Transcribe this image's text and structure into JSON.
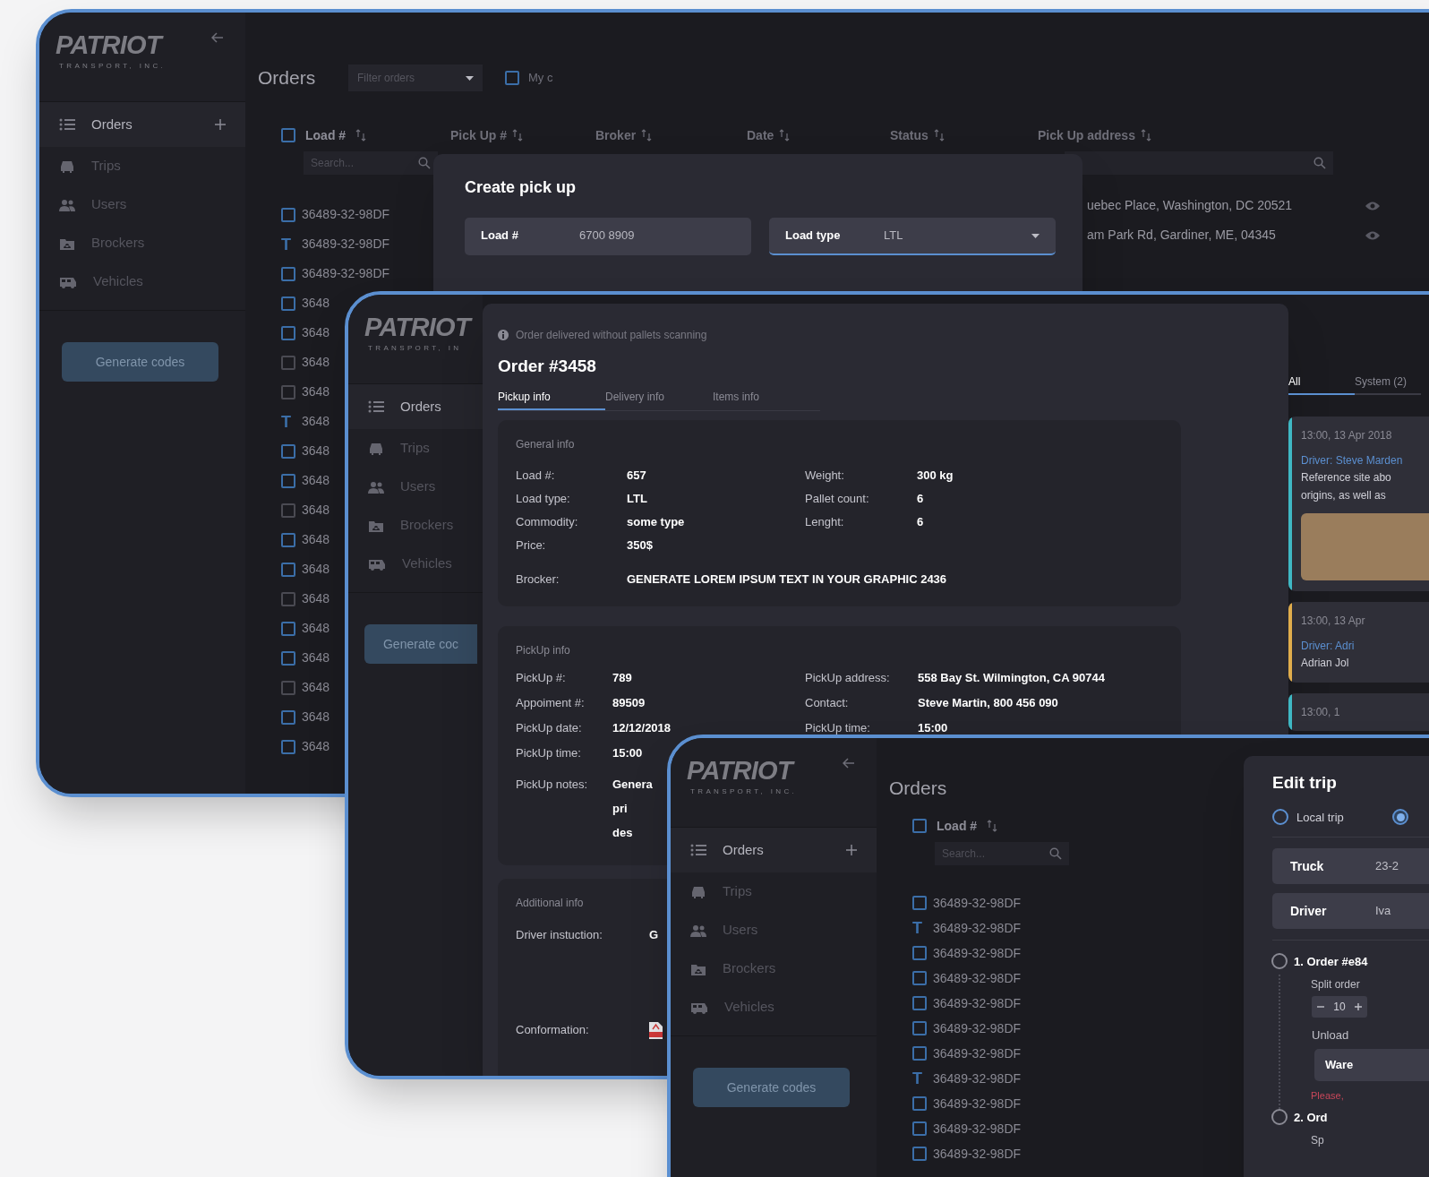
{
  "screens": [
    {
      "kind": "orders_overview",
      "logo": "PATRIOT",
      "logo_tagline": "TRANSPORT, INC.",
      "nav": [
        {
          "label": "Orders",
          "selected": true
        },
        {
          "label": "Trips",
          "selected": false
        },
        {
          "label": "Users",
          "selected": false
        },
        {
          "label": "Brockers",
          "selected": false
        },
        {
          "label": "Vehicles",
          "selected": false
        }
      ],
      "sidebar_button": "Generate codes",
      "title": "Orders",
      "filter_placeholder": "Filter orders",
      "mine": {
        "label": "My c",
        "checked": false
      },
      "select_all": {
        "checked": false
      },
      "columns": [
        "Load #",
        "Pick Up #",
        "Broker",
        "Date",
        "Status",
        "Pick Up address"
      ],
      "search_placeholder": "Search...",
      "rows": [
        {
          "kind": "checkbox",
          "checked": false,
          "disabled": false,
          "text": "36489-32-98DF"
        },
        {
          "kind": "mark",
          "mark": "T",
          "text": "36489-32-98DF"
        },
        {
          "kind": "checkbox",
          "checked": false,
          "disabled": false,
          "text": "36489-32-98DF"
        },
        {
          "kind": "checkbox",
          "checked": false,
          "disabled": false,
          "text": "3648"
        },
        {
          "kind": "checkbox",
          "checked": false,
          "disabled": false,
          "text": "3648"
        },
        {
          "kind": "checkbox",
          "checked": false,
          "disabled": true,
          "text": "3648"
        },
        {
          "kind": "checkbox",
          "checked": false,
          "disabled": true,
          "text": "3648"
        },
        {
          "kind": "mark",
          "mark": "T",
          "text": "3648"
        },
        {
          "kind": "checkbox",
          "checked": false,
          "disabled": false,
          "text": "3648"
        },
        {
          "kind": "checkbox",
          "checked": false,
          "disabled": false,
          "text": "3648"
        },
        {
          "kind": "checkbox",
          "checked": false,
          "disabled": true,
          "text": "3648"
        },
        {
          "kind": "checkbox",
          "checked": false,
          "disabled": false,
          "text": "3648"
        },
        {
          "kind": "checkbox",
          "checked": false,
          "disabled": false,
          "text": "3648"
        },
        {
          "kind": "checkbox",
          "checked": false,
          "disabled": true,
          "text": "3648"
        },
        {
          "kind": "checkbox",
          "checked": false,
          "disabled": false,
          "text": "3648"
        },
        {
          "kind": "checkbox",
          "checked": false,
          "disabled": false,
          "text": "3648"
        },
        {
          "kind": "checkbox",
          "checked": false,
          "disabled": true,
          "text": "3648"
        },
        {
          "kind": "checkbox",
          "checked": false,
          "disabled": false,
          "text": "3648"
        },
        {
          "kind": "checkbox",
          "checked": false,
          "disabled": false,
          "text": "3648"
        }
      ],
      "addresses": [
        "uebec Place, Washington, DC 20521",
        "am Park Rd, Gardiner, ME, 04345"
      ],
      "modal": {
        "title": "Create pick up",
        "fields": [
          {
            "kind": "text",
            "label": "Load #",
            "value": "6700 8909",
            "focused": false
          },
          {
            "kind": "select",
            "label": "Load type",
            "value": "LTL",
            "focused": true
          }
        ]
      }
    },
    {
      "kind": "order_detail",
      "logo": "PATRIOT",
      "logo_tagline": "TRANSPORT, IN",
      "nav": [
        {
          "label": "Orders",
          "selected": true
        },
        {
          "label": "Trips",
          "selected": false
        },
        {
          "label": "Users",
          "selected": false
        },
        {
          "label": "Brockers",
          "selected": false
        },
        {
          "label": "Vehicles",
          "selected": false
        }
      ],
      "sidebar_button": "Generate coc",
      "notice": "Order delivered without pallets scanning",
      "title": "Order #3458",
      "tabs": [
        {
          "label": "Pickup info",
          "selected": true
        },
        {
          "label": "Delivery info",
          "selected": false
        },
        {
          "label": "Items info",
          "selected": false
        }
      ],
      "sections": [
        {
          "title": "General info",
          "fields": [
            {
              "label": "Load #:",
              "value": "657"
            },
            {
              "label": "Load type:",
              "value": "LTL"
            },
            {
              "label": "Commodity:",
              "value": "some type"
            },
            {
              "label": "Price:",
              "value": "350$"
            }
          ],
          "side_fields": [
            {
              "label": "Weight:",
              "value": "300 kg"
            },
            {
              "label": "Pallet count:",
              "value": "6"
            },
            {
              "label": "Lenght:",
              "value": "6"
            }
          ],
          "wide_fields": [
            {
              "label": "Brocker:",
              "value": "GENERATE LOREM IPSUM TEXT IN YOUR GRAPHIC 2436"
            }
          ]
        },
        {
          "title": "PickUp info",
          "fields": [
            {
              "label": "PickUp #:",
              "value": "789"
            },
            {
              "label": "Appoiment #:",
              "value": "89509"
            },
            {
              "label": "PickUp date:",
              "value": "12/12/2018"
            },
            {
              "label": "PickUp time:",
              "value": "15:00"
            }
          ],
          "side_fields": [
            {
              "label": "PickUp address:",
              "value": "558 Bay St. Wilmington, CA 90744"
            },
            {
              "label": "Contact:",
              "value": "Steve Martin, 800 456 090"
            },
            {
              "label": "PickUp time:",
              "value": "15:00"
            }
          ],
          "wide_fields": [
            {
              "label": "PickUp notes:",
              "value_lines": [
                "Genera",
                "pri",
                "des"
              ]
            }
          ]
        },
        {
          "title": "Additional info",
          "fields": [
            {
              "label": "Driver instuction:",
              "value": "G"
            },
            {
              "label": "Conformation:",
              "kind": "file"
            }
          ]
        }
      ],
      "feed_tabs": [
        {
          "label": "All",
          "selected": true
        },
        {
          "label": "System (2)",
          "selected": false
        }
      ],
      "feed": [
        {
          "time": "13:00, 13 Apr 2018",
          "author": "Driver: Steve Marden",
          "lines": [
            "Reference site abo",
            "origins, as well as"
          ],
          "photo": true,
          "color": "#3fb8c4"
        },
        {
          "time": "13:00, 13 Apr",
          "author": "Driver: Adri",
          "lines": [
            "Adrian Jol"
          ],
          "color": "#e0ad4c"
        },
        {
          "time": "13:00, 1",
          "color": "#3fb8c4"
        }
      ]
    },
    {
      "kind": "trip_editor",
      "logo": "PATRIOT",
      "logo_tagline": "TRANSPORT, INC.",
      "nav": [
        {
          "label": "Orders",
          "selected": true
        },
        {
          "label": "Trips",
          "selected": false
        },
        {
          "label": "Users",
          "selected": false
        },
        {
          "label": "Brockers",
          "selected": false
        },
        {
          "label": "Vehicles",
          "selected": false
        }
      ],
      "sidebar_button": "Generate codes",
      "title": "Orders",
      "columns": [
        "Load #"
      ],
      "search_placeholder": "Search...",
      "select_all": {
        "checked": false
      },
      "rows": [
        {
          "kind": "checkbox",
          "checked": false,
          "text": "36489-32-98DF"
        },
        {
          "kind": "mark",
          "mark": "T",
          "text": "36489-32-98DF"
        },
        {
          "kind": "checkbox",
          "checked": false,
          "text": "36489-32-98DF"
        },
        {
          "kind": "checkbox",
          "checked": false,
          "text": "36489-32-98DF"
        },
        {
          "kind": "checkbox",
          "checked": false,
          "text": "36489-32-98DF"
        },
        {
          "kind": "checkbox",
          "checked": false,
          "text": "36489-32-98DF"
        },
        {
          "kind": "checkbox",
          "checked": false,
          "text": "36489-32-98DF"
        },
        {
          "kind": "mark",
          "mark": "T",
          "text": "36489-32-98DF"
        },
        {
          "kind": "checkbox",
          "checked": false,
          "text": "36489-32-98DF"
        },
        {
          "kind": "checkbox",
          "checked": false,
          "text": "36489-32-98DF"
        },
        {
          "kind": "checkbox",
          "checked": false,
          "text": "36489-32-98DF"
        }
      ],
      "editor": {
        "title": "Edit trip",
        "trip_types": [
          {
            "label": "Local trip",
            "selected": false
          },
          {
            "selected": true
          }
        ],
        "fields": [
          {
            "label": "Truck",
            "value": "23-2"
          },
          {
            "label": "Driver",
            "value": "Iva"
          }
        ],
        "orders": [
          {
            "title": "1. Order #e84",
            "selected": false,
            "split_label": "Split order",
            "quantity": "10",
            "unload_label": "Unload",
            "unload_value": "Ware",
            "error": "Please,"
          },
          {
            "title": "2. Ord",
            "selected": false,
            "split_label": "Sp"
          }
        ]
      }
    }
  ]
}
